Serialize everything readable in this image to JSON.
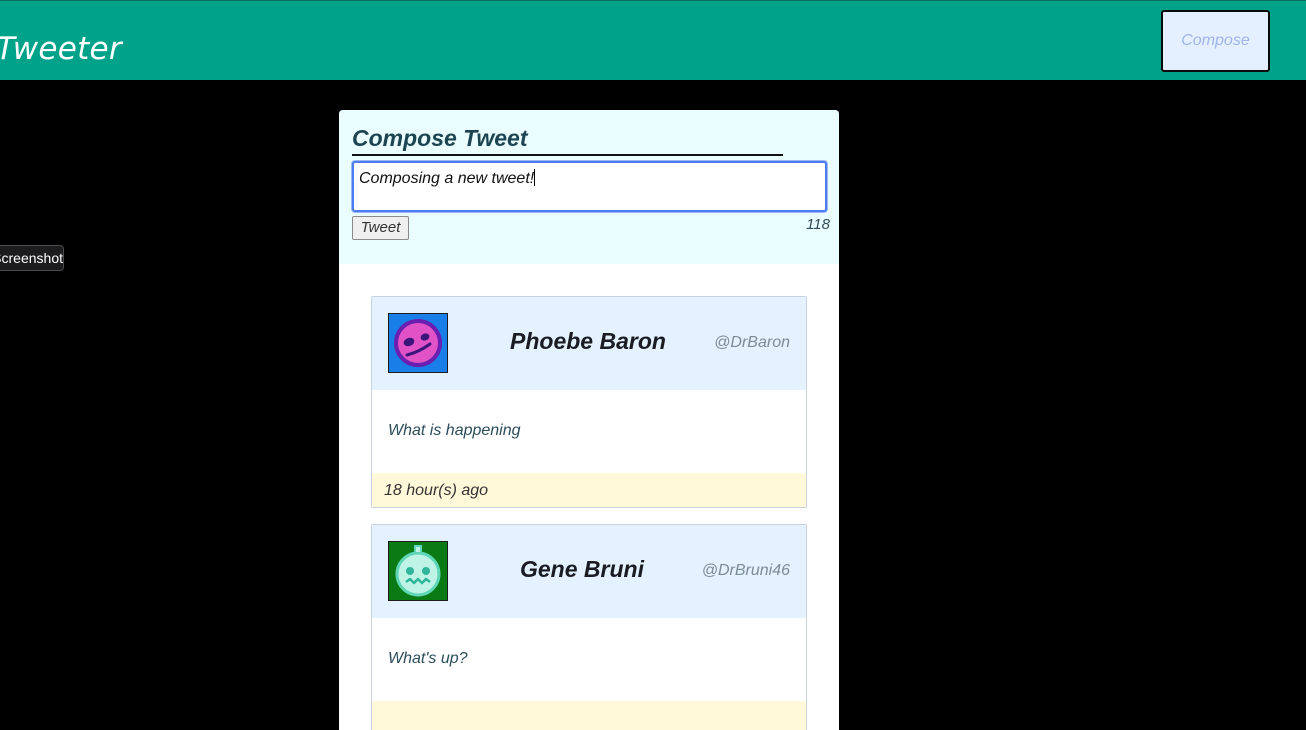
{
  "nav": {
    "brand": "Tweeter",
    "compose_label": "Compose"
  },
  "tooltip": {
    "text": "Screenshot"
  },
  "compose": {
    "title": "Compose Tweet",
    "input_value": "Composing a new tweet!",
    "tweet_button": "Tweet",
    "char_counter": "118"
  },
  "tweets": [
    {
      "name": "Phoebe Baron",
      "handle": "@DrBaron",
      "text": "What is happening",
      "time": "18 hour(s) ago",
      "avatar_icon": "worried-face-icon",
      "avatar_bg": "#1a7ee8"
    },
    {
      "name": "Gene Bruni",
      "handle": "@DrBruni46",
      "text": "What's up?",
      "time": "",
      "avatar_icon": "grimace-robot-face-icon",
      "avatar_bg": "#0a7a14"
    }
  ],
  "colors": {
    "nav_bg": "#00a389",
    "compose_panel_bg": "#ebfeff",
    "tweet_header_bg": "#e4f1ff",
    "tweet_footer_bg": "#fff8d9",
    "page_bg": "#000000"
  }
}
